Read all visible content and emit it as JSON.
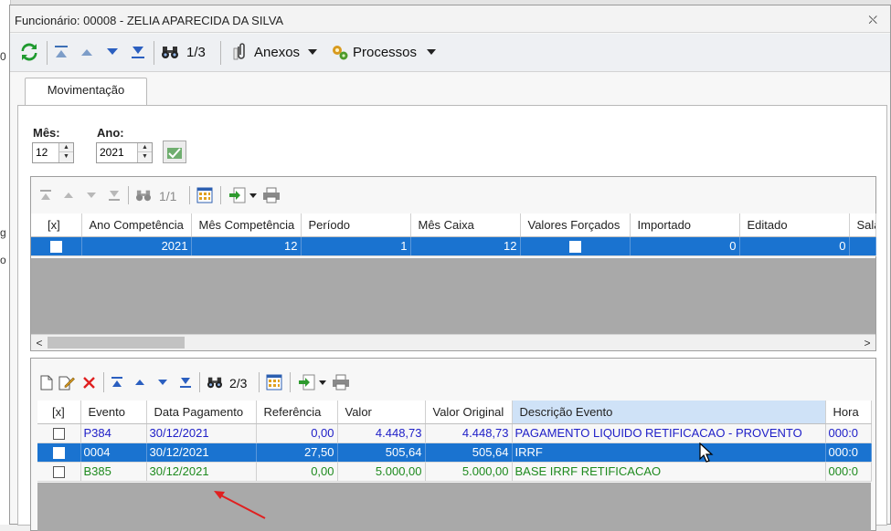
{
  "window": {
    "title": "Funcionário: 00008 - ZELIA APARECIDA DA SILVA",
    "close_glyph": "⛌"
  },
  "toolbar": {
    "record_counter": "1/3",
    "anexos_label": "Anexos",
    "processos_label": "Processos"
  },
  "tabs": [
    {
      "label": "Movimentação"
    }
  ],
  "filters": {
    "mes_label": "Mês:",
    "mes_value": "12",
    "ano_label": "Ano:",
    "ano_value": "2021"
  },
  "grid1": {
    "counter": "1/1",
    "columns": [
      "[x]",
      "Ano Competência",
      "Mês Competência",
      "Período",
      "Mês Caixa",
      "Valores Forçados",
      "Importado",
      "Editado",
      "Sala"
    ],
    "rows": [
      {
        "ano": "2021",
        "mes": "12",
        "periodo": "1",
        "mes_caixa": "12",
        "importado": "0",
        "editado": "0"
      }
    ]
  },
  "grid2": {
    "counter": "2/3",
    "columns": [
      "[x]",
      "Evento",
      "Data Pagamento",
      "Referência",
      "Valor",
      "Valor Original",
      "Descrição Evento",
      "Hora"
    ],
    "rows": [
      {
        "evento": "P384",
        "data": "30/12/2021",
        "referencia": "0,00",
        "valor": "4.448,73",
        "valor_original": "4.448,73",
        "descricao": "PAGAMENTO LIQUIDO RETIFICACAO - PROVENTO",
        "hora": "000:0",
        "color": "blue"
      },
      {
        "evento": "0004",
        "data": "30/12/2021",
        "referencia": "27,50",
        "valor": "505,64",
        "valor_original": "505,64",
        "descricao": "IRRF",
        "hora": "000:0",
        "color": "selected"
      },
      {
        "evento": "B385",
        "data": "30/12/2021",
        "referencia": "0,00",
        "valor": "5.000,00",
        "valor_original": "5.000,00",
        "descricao": "BASE IRRF RETIFICACAO",
        "hora": "000:0",
        "color": "green"
      }
    ]
  },
  "background_fragments": [
    "0",
    "g",
    "o"
  ]
}
